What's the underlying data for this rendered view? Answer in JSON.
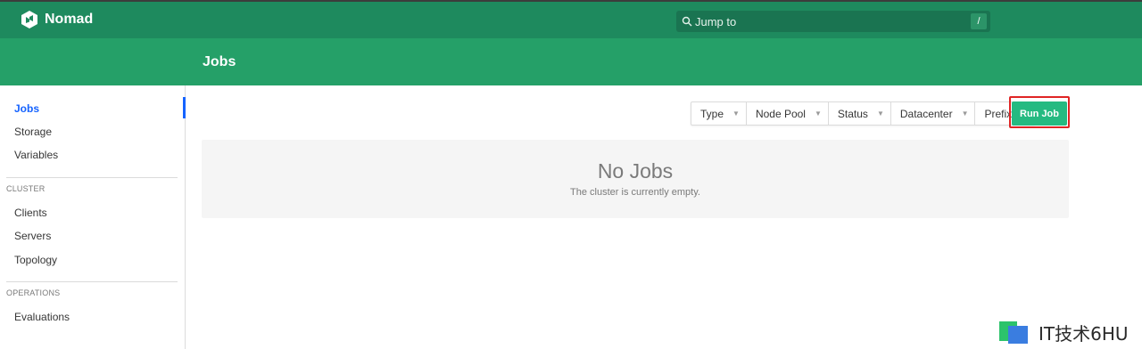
{
  "header": {
    "brand": "Nomad",
    "search_placeholder": "Jump to",
    "search_shortcut": "/"
  },
  "page": {
    "title": "Jobs"
  },
  "sidebar": {
    "items_top": [
      {
        "label": "Jobs",
        "active": true
      },
      {
        "label": "Storage",
        "active": false
      },
      {
        "label": "Variables",
        "active": false
      }
    ],
    "sections": [
      {
        "title": "CLUSTER",
        "items": [
          "Clients",
          "Servers",
          "Topology"
        ]
      },
      {
        "title": "OPERATIONS",
        "items": [
          "Evaluations"
        ]
      }
    ]
  },
  "filters": [
    "Type",
    "Node Pool",
    "Status",
    "Datacenter",
    "Prefix"
  ],
  "actions": {
    "run_job": "Run Job"
  },
  "empty_state": {
    "title": "No Jobs",
    "message": "The cluster is currently empty."
  },
  "watermark": {
    "text": "IT技术6HU"
  },
  "colors": {
    "topbar": "#1e8a5e",
    "subheader": "#25a068",
    "run_job": "#25ba81",
    "active_link": "#1563ff",
    "highlight_frame": "#e02424"
  }
}
